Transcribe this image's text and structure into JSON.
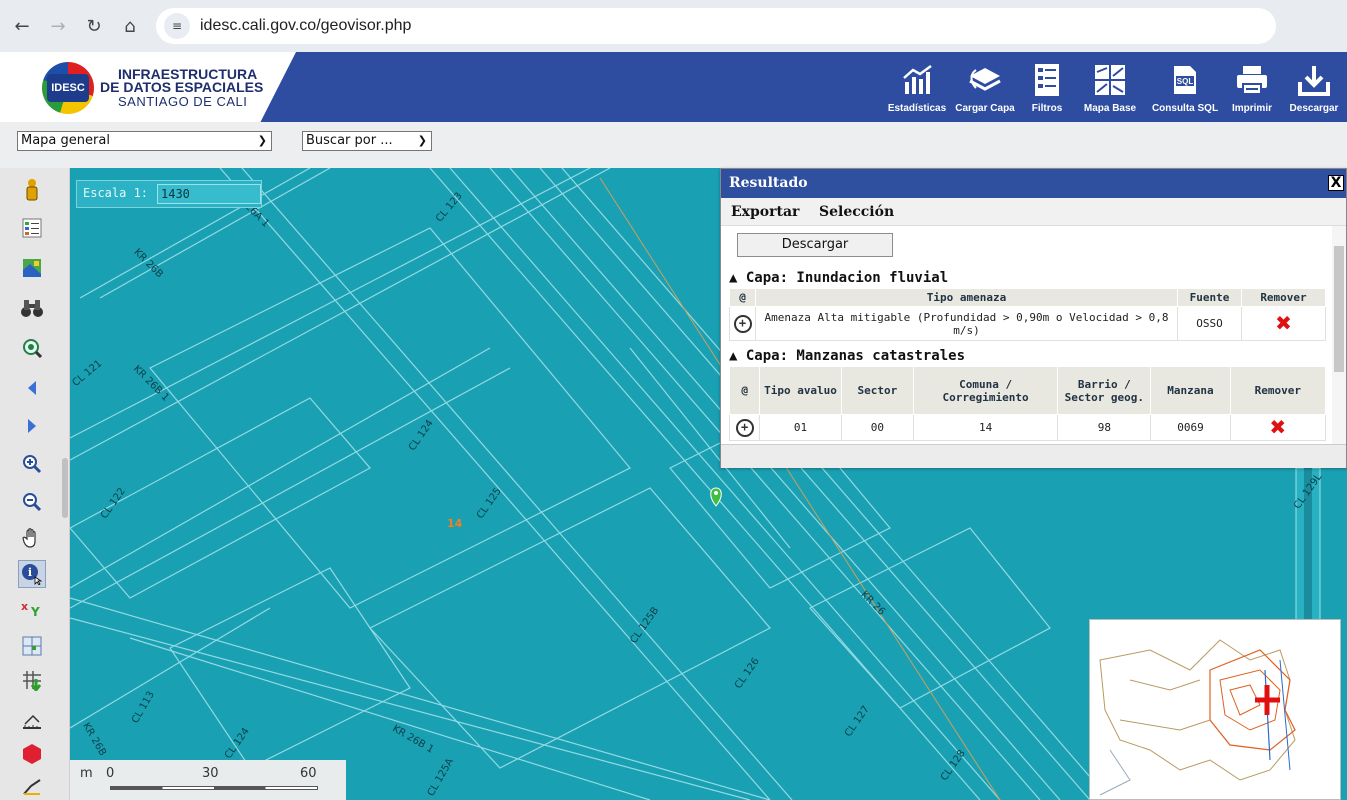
{
  "browser": {
    "url": "idesc.cali.gov.co/geovisor.php"
  },
  "header": {
    "logo_badge": "IDESC",
    "logo_line1": "INFRAESTRUCTURA",
    "logo_line2": "DE DATOS ESPACIALES",
    "logo_line3": "SANTIAGO DE CALI",
    "tools": [
      {
        "label": "Estadísticas",
        "icon": "bar-chart-icon"
      },
      {
        "label": "Cargar Capa",
        "icon": "layers-icon"
      },
      {
        "label": "Filtros",
        "icon": "filter-icon"
      },
      {
        "label": "Mapa Base",
        "icon": "basemap-icon"
      },
      {
        "label": "Consulta SQL",
        "icon": "sql-icon"
      },
      {
        "label": "Imprimir",
        "icon": "printer-icon"
      },
      {
        "label": "Descargar",
        "icon": "download-icon"
      }
    ]
  },
  "selectors": {
    "map_select": "Mapa general",
    "search_select": "Buscar por ..."
  },
  "map": {
    "scale_label": "Escala 1:",
    "scale_value": "1430",
    "comuna_label": "14",
    "street_labels": [
      "KR 26A 1",
      "CL 123",
      "KR 26B",
      "CL 121",
      "KR 26B 1",
      "CL 124",
      "CL 125",
      "CL 122",
      "CL 125B",
      "KR 26",
      "CL 126",
      "CL 127",
      "CL 128",
      "CL 113",
      "CL 124",
      "KR 26B 1",
      "CL 125A",
      "KR 26B",
      "CL 129L"
    ],
    "scalebar": {
      "unit": "m",
      "ticks": [
        "0",
        "30",
        "60"
      ]
    }
  },
  "result_panel": {
    "title": "Resultado",
    "close": "X",
    "menu": [
      "Exportar",
      "Selección"
    ],
    "download_button": "Descargar",
    "layer1": {
      "title": "▲ Capa: Inundacion fluvial",
      "headers": [
        "@",
        "Tipo amenaza",
        "Fuente",
        "Remover"
      ],
      "rows": [
        {
          "tipo": "Amenaza Alta mitigable (Profundidad > 0,90m o Velocidad > 0,8 m/s)",
          "fuente": "OSSO"
        }
      ]
    },
    "layer2": {
      "title": "▲ Capa: Manzanas catastrales",
      "headers": [
        "@",
        "Tipo avaluo",
        "Sector",
        "Comuna / Corregimiento",
        "Barrio / Sector geog.",
        "Manzana",
        "Remover"
      ],
      "rows": [
        {
          "tipo_avaluo": "01",
          "sector": "00",
          "comuna": "14",
          "barrio": "98",
          "manzana": "0069"
        }
      ]
    }
  },
  "colors": {
    "header_blue": "#2e4da0",
    "map_teal": "#1aa0b3",
    "remove_red": "#e01010"
  }
}
